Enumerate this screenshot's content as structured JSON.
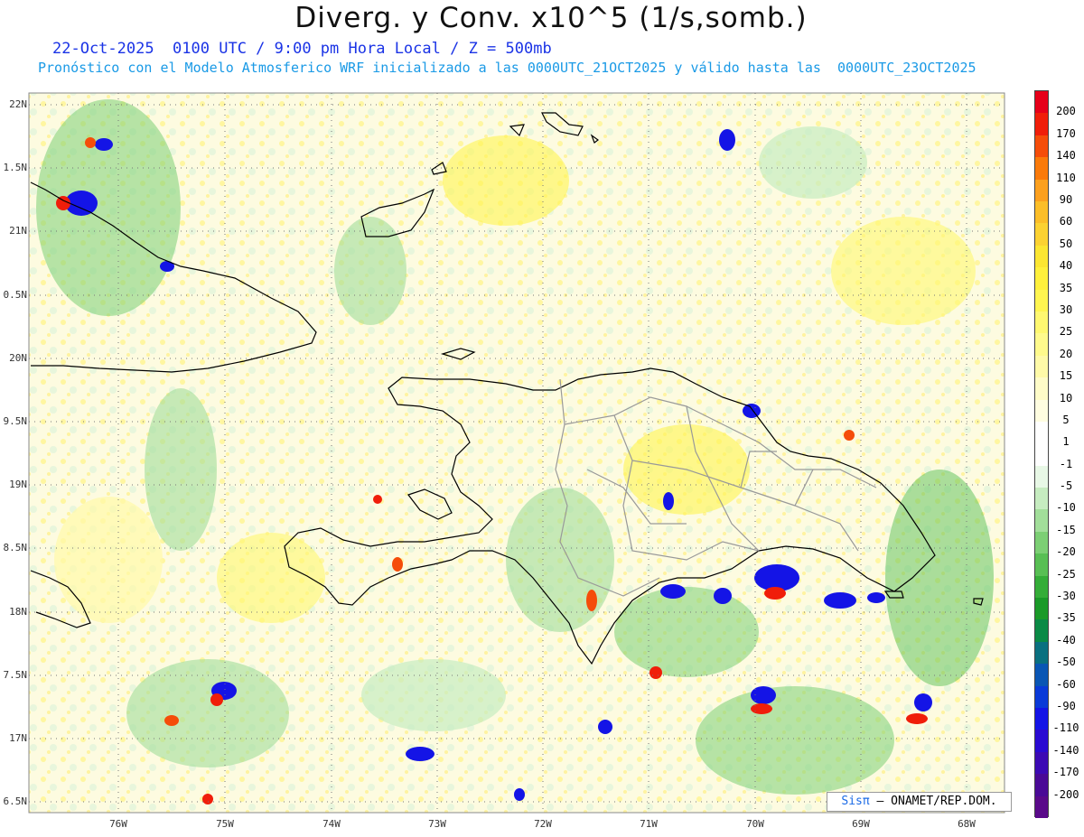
{
  "header": {
    "title": "Diverg. y Conv. x10^5 (1/s,somb.)",
    "line1": "22-Oct-2025  0100 UTC / 9:00 pm Hora Local / Z = 500mb",
    "line2": "Pronóstico con el Modelo Atmosferico WRF inicializado a las 0000UTC_21OCT2025 y válido hasta las  0000UTC_23OCT2025"
  },
  "axes": {
    "lat_labels": [
      "22N",
      "1.5N",
      "21N",
      "0.5N",
      "20N",
      "9.5N",
      "19N",
      "8.5N",
      "18N",
      "7.5N",
      "17N",
      "6.5N"
    ],
    "lon_labels": [
      "76W",
      "75W",
      "74W",
      "73W",
      "72W",
      "71W",
      "70W",
      "69W",
      "68W"
    ]
  },
  "colorbar": {
    "labels": [
      "200",
      "170",
      "140",
      "110",
      "90",
      "60",
      "50",
      "40",
      "35",
      "30",
      "25",
      "20",
      "15",
      "10",
      "5",
      "1",
      "-1",
      "-5",
      "-10",
      "-15",
      "-20",
      "-25",
      "-30",
      "-35",
      "-40",
      "-50",
      "-60",
      "-90",
      "-110",
      "-140",
      "-170",
      "-200"
    ],
    "colors": [
      "#e6001a",
      "#f01e0a",
      "#f54d0a",
      "#fa7a0a",
      "#fca01e",
      "#fcbe28",
      "#fcd232",
      "#fce632",
      "#fff03c",
      "#fff550",
      "#fff870",
      "#fffa8c",
      "#fffaa8",
      "#fffcc8",
      "#fffde0",
      "#ffffff",
      "#ffffff",
      "#e8f8e6",
      "#c6ecc0",
      "#a2de9a",
      "#7ccf74",
      "#58bf54",
      "#34ad38",
      "#1a9a28",
      "#0a8a46",
      "#0a7080",
      "#0a56b4",
      "#0a3ad8",
      "#1414e6",
      "#2a0ad2",
      "#3c0ab4",
      "#4a0a96",
      "#5a0a8a"
    ]
  },
  "credit": {
    "logo": "Sisπ",
    "text": "– ONAMET/REP.DOM."
  }
}
